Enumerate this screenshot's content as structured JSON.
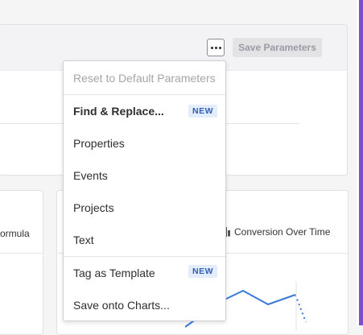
{
  "toolbar": {
    "more_label": "More options",
    "save_label": "Save Parameters"
  },
  "cards": {
    "left_label": "ormula",
    "right_title": "Conversion Over Time"
  },
  "menu": {
    "items": [
      {
        "label": "Reset to Default Parameters",
        "disabled": true
      },
      {
        "label": "Find & Replace...",
        "badge": "NEW",
        "bold": true
      },
      {
        "label": "Properties"
      },
      {
        "label": "Events"
      },
      {
        "label": "Projects"
      },
      {
        "label": "Text"
      },
      {
        "label": "Tag as Template",
        "badge": "NEW"
      },
      {
        "label": "Save onto Charts..."
      }
    ]
  },
  "colors": {
    "accent_purple": "#7a4fc9",
    "badge_bg": "#e4edfb",
    "badge_text": "#2f5fb3",
    "chart_line": "#3b7ad9"
  }
}
